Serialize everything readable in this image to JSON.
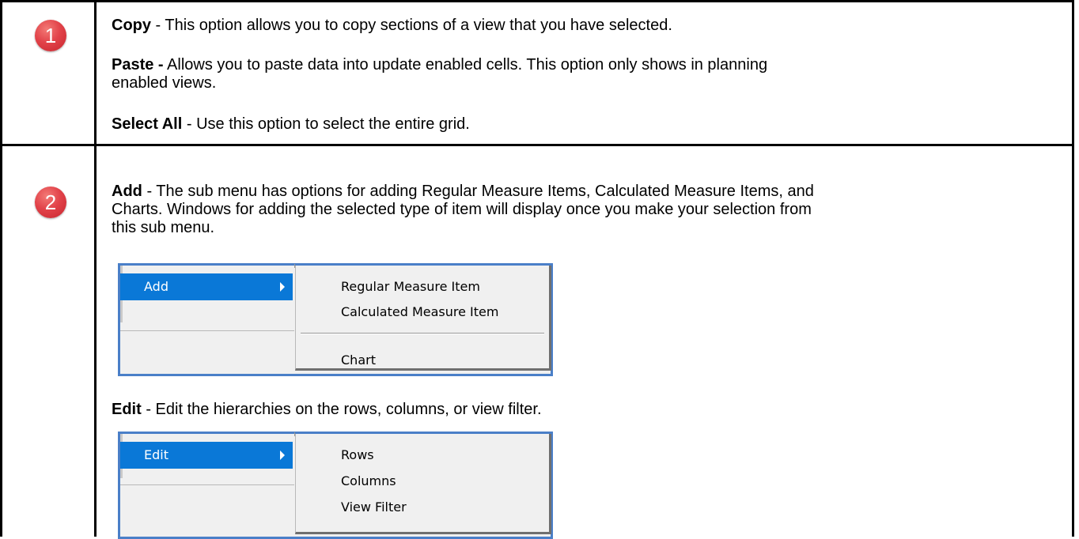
{
  "rows": [
    {
      "badge": "1",
      "paragraphs": [
        {
          "bold": "Copy",
          "text": " - This option allows you to copy sections of a view that you have selected."
        },
        {
          "bold": "Paste -",
          "text": " Allows you to paste data into update enabled cells. This option only shows in planning",
          "text2": "enabled views."
        },
        {
          "bold": "Select All",
          "text": " - Use this option to select the entire grid."
        }
      ]
    },
    {
      "badge": "2",
      "add_para": {
        "bold": "Add",
        "line1": " - The sub menu has options for adding Regular Measure Items, Calculated Measure Items, and",
        "line2": "Charts. Windows for adding the selected type of item will display once you make your selection from",
        "line3": "this sub menu."
      },
      "add_menu": {
        "highlighted": "Add",
        "items": [
          "Regular Measure Item",
          "Calculated Measure Item",
          "Chart"
        ]
      },
      "edit_para": {
        "bold": "Edit",
        "text": " - Edit the hierarchies on the rows, columns, or view filter."
      },
      "edit_menu": {
        "highlighted": "Edit",
        "items": [
          "Rows",
          "Columns",
          "View Filter"
        ]
      }
    }
  ],
  "colors": {
    "highlight": "#0a78d7",
    "menu_border": "#4a7fc8",
    "badge": "#e2434a"
  }
}
